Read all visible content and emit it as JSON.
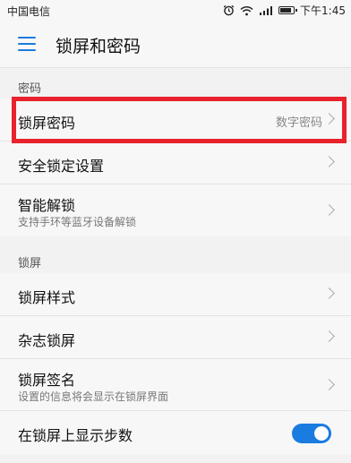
{
  "status_bar": {
    "carrier": "中国电信",
    "time": "下午1:45",
    "icons": [
      "alarm-icon",
      "wifi-icon",
      "signal-icon",
      "battery-icon"
    ]
  },
  "header": {
    "title": "锁屏和密码",
    "menu_icon": "hamburger-menu-icon",
    "accent_color": "#1a7be0"
  },
  "sections": [
    {
      "title": "密码",
      "items": [
        {
          "label": "锁屏密码",
          "value": "数字密码",
          "highlighted": true
        },
        {
          "label": "安全锁定设置"
        },
        {
          "label": "智能解锁",
          "subtitle": "支持手环等蓝牙设备解锁"
        }
      ]
    },
    {
      "title": "锁屏",
      "items": [
        {
          "label": "锁屏样式"
        },
        {
          "label": "杂志锁屏"
        },
        {
          "label": "锁屏签名",
          "subtitle": "设置的信息将会显示在锁屏界面"
        },
        {
          "label": "在锁屏上显示步数",
          "toggle": true
        }
      ]
    }
  ],
  "highlight_color": "#e8232b"
}
